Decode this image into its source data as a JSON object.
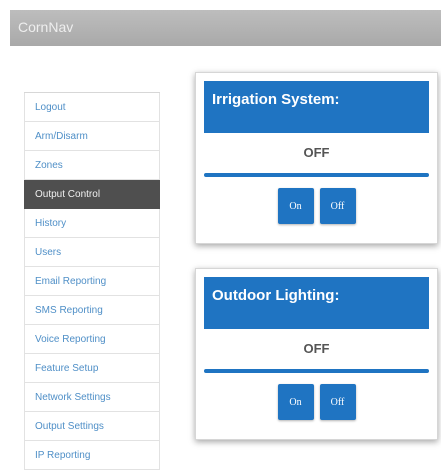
{
  "app": {
    "title": "CornNav"
  },
  "sidebar": {
    "items": [
      {
        "label": "Logout",
        "active": false
      },
      {
        "label": "Arm/Disarm",
        "active": false
      },
      {
        "label": "Zones",
        "active": false
      },
      {
        "label": "Output Control",
        "active": true
      },
      {
        "label": "History",
        "active": false
      },
      {
        "label": "Users",
        "active": false
      },
      {
        "label": "Email Reporting",
        "active": false
      },
      {
        "label": "SMS Reporting",
        "active": false
      },
      {
        "label": "Voice Reporting",
        "active": false
      },
      {
        "label": "Feature Setup",
        "active": false
      },
      {
        "label": "Network Settings",
        "active": false
      },
      {
        "label": "Output Settings",
        "active": false
      },
      {
        "label": "IP Reporting",
        "active": false
      }
    ]
  },
  "outputs": [
    {
      "name": "Irrigation System:",
      "status": "OFF",
      "on_label": "On",
      "off_label": "Off"
    },
    {
      "name": "Outdoor Lighting:",
      "status": "OFF",
      "on_label": "On",
      "off_label": "Off"
    }
  ],
  "colors": {
    "accent": "#1f74c2",
    "nav_link": "#4f8fc7",
    "nav_active_bg": "#4f4f4f",
    "header_bg": "#b3b3b3"
  }
}
